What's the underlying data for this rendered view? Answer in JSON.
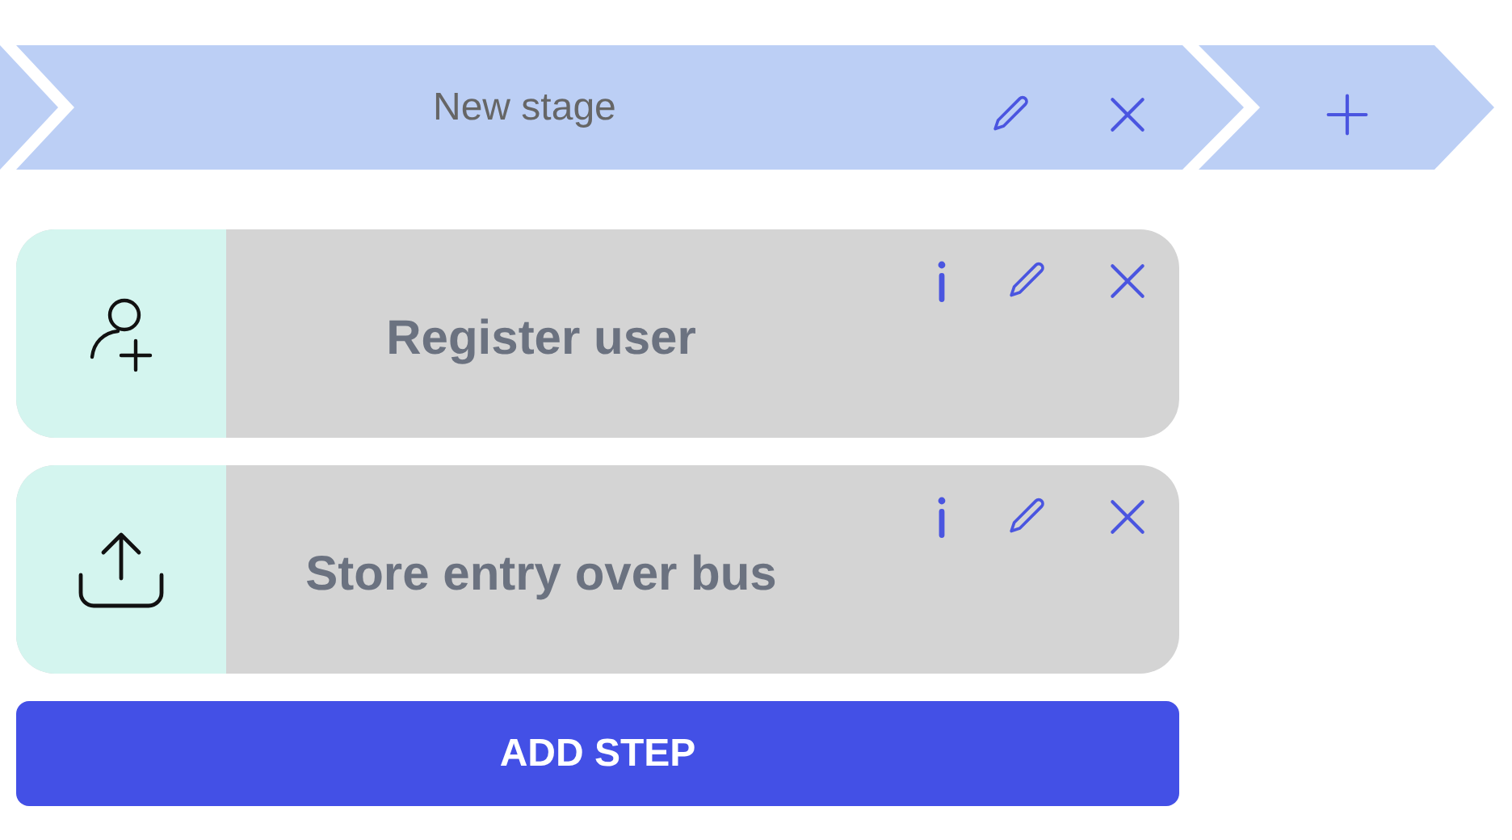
{
  "stage": {
    "title": "New stage"
  },
  "steps": [
    {
      "title": "Register user",
      "kind": "user-add"
    },
    {
      "title": "Store entry over bus",
      "kind": "upload"
    }
  ],
  "add_button": {
    "label": "ADD STEP"
  }
}
